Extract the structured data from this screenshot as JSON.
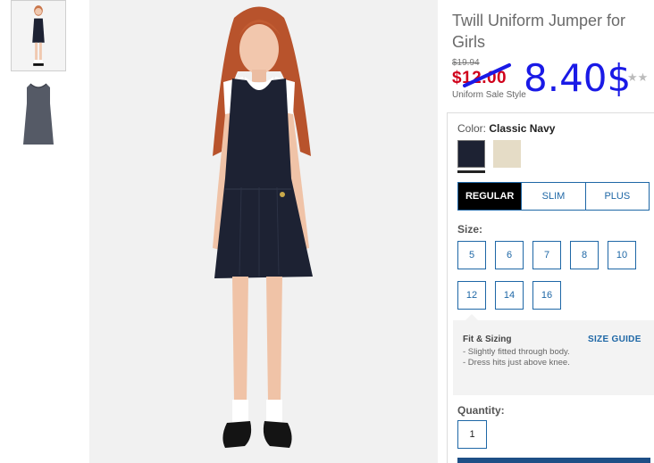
{
  "product": {
    "title": "Twill Uniform Jumper for Girls",
    "original_price": "$19.94",
    "sale_price": "$12.00",
    "sale_label": "Uniform Sale Style",
    "handwritten_price": "8.40$",
    "rating_stars": "★★"
  },
  "color": {
    "label": "Color:",
    "selected_name": "Classic Navy",
    "swatches": [
      {
        "name": "Classic Navy",
        "hex": "#1d2233"
      },
      {
        "name": "Khaki",
        "hex": "#e5dcc6"
      }
    ]
  },
  "fit_tabs": [
    "REGULAR",
    "SLIM",
    "PLUS"
  ],
  "size": {
    "label": "Size:",
    "options": [
      "5",
      "6",
      "7",
      "8",
      "10",
      "12",
      "14",
      "16"
    ]
  },
  "fit_sizing": {
    "title": "Fit & Sizing",
    "guide_link": "SIZE GUIDE",
    "items": [
      "- Slightly fitted through body.",
      "- Dress hits just above knee."
    ]
  },
  "quantity": {
    "label": "Quantity:",
    "value": "1"
  },
  "colors": {
    "accent": "#1e67a6",
    "sale": "#d0021b",
    "handwritten": "#1a1ae6"
  }
}
